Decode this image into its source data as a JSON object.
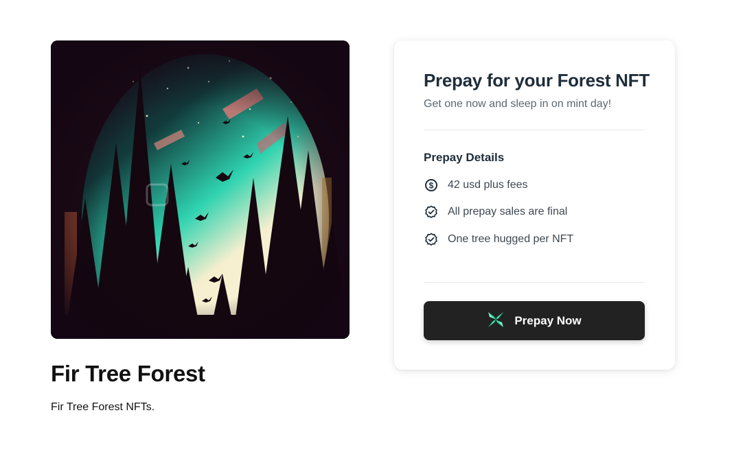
{
  "product": {
    "title": "Fir Tree Forest",
    "description": "Fir Tree Forest NFTs."
  },
  "card": {
    "title": "Prepay for your Forest NFT",
    "subtitle": "Get one now and sleep in on mint day!",
    "details_heading": "Prepay Details",
    "details": [
      {
        "icon": "dollar-circle-icon",
        "label": "42 usd plus fees"
      },
      {
        "icon": "check-badge-icon",
        "label": "All prepay sales are final"
      },
      {
        "icon": "check-badge-icon",
        "label": "One tree hugged per NFT"
      }
    ],
    "button_label": "Prepay Now",
    "button_icon": "x-logo-icon"
  },
  "colors": {
    "button_bg": "#222222",
    "logo_accent": "#2ee6a8",
    "sky_teal": "#2fd3b0",
    "sky_glow": "#f6efcf"
  }
}
